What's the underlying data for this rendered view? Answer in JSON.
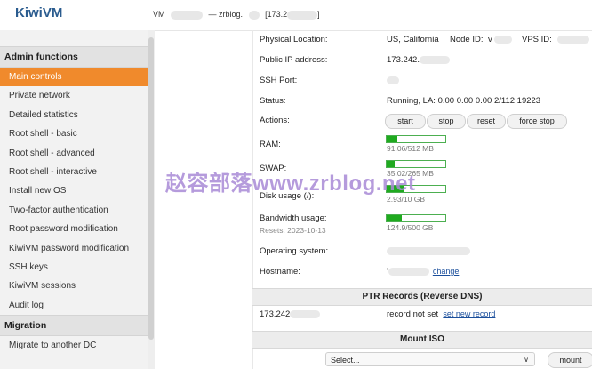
{
  "app": {
    "logo": "KiwiVM",
    "vm_title_prefix": "VM",
    "vm_title_sep": "— zrblog.",
    "vm_title_ip_prefix": "[173.2",
    "vm_title_suffix": "]"
  },
  "sidebar": {
    "sections": [
      {
        "title": "Admin functions",
        "items": [
          "Main controls",
          "Private network",
          "Detailed statistics",
          "Root shell - basic",
          "Root shell - advanced",
          "Root shell - interactive",
          "Install new OS",
          "Two-factor authentication",
          "Root password modification",
          "KiwiVM password modification",
          "SSH keys",
          "KiwiVM sessions",
          "Audit log"
        ],
        "active": "Main controls"
      },
      {
        "title": "Migration",
        "items": [
          "Migrate to another DC"
        ]
      }
    ]
  },
  "main": {
    "physical_location": {
      "label": "Physical Location:",
      "value": "US, California",
      "node_label": "Node ID:",
      "node_value": "v",
      "vps_label": "VPS ID:"
    },
    "public_ip": {
      "label": "Public IP address:",
      "value": "173.242."
    },
    "ssh_port": {
      "label": "SSH Port:"
    },
    "status": {
      "label": "Status:",
      "value": "Running, LA: 0.00 0.00 0.00 2/112 19223"
    },
    "actions": {
      "label": "Actions:",
      "buttons": [
        "start",
        "stop",
        "reset",
        "force stop"
      ]
    },
    "ram": {
      "label": "RAM:",
      "used_text": "91.06/512 MB",
      "fraction": 0.178
    },
    "swap": {
      "label": "SWAP:",
      "used_text": "35.02/265 MB",
      "fraction": 0.132
    },
    "disk": {
      "label": "Disk usage (/):",
      "used_text": "2.93/10 GB",
      "fraction": 0.293
    },
    "bandwidth": {
      "label": "Bandwidth usage:",
      "resets": "Resets: 2023-10-13",
      "used_text": "124.9/500 GB",
      "fraction": 0.25
    },
    "os": {
      "label": "Operating system:"
    },
    "hostname": {
      "label": "Hostname:",
      "prefix": "'",
      "change_link": "change"
    },
    "ptr": {
      "title": "PTR Records (Reverse DNS)",
      "ip": "173.242",
      "status": "record not set",
      "set_link": "set new record"
    },
    "mount_iso": {
      "title": "Mount ISO",
      "select_value": "Select...",
      "mount_button": "mount"
    }
  },
  "watermark": "赵容部落www.zrblog.net"
}
